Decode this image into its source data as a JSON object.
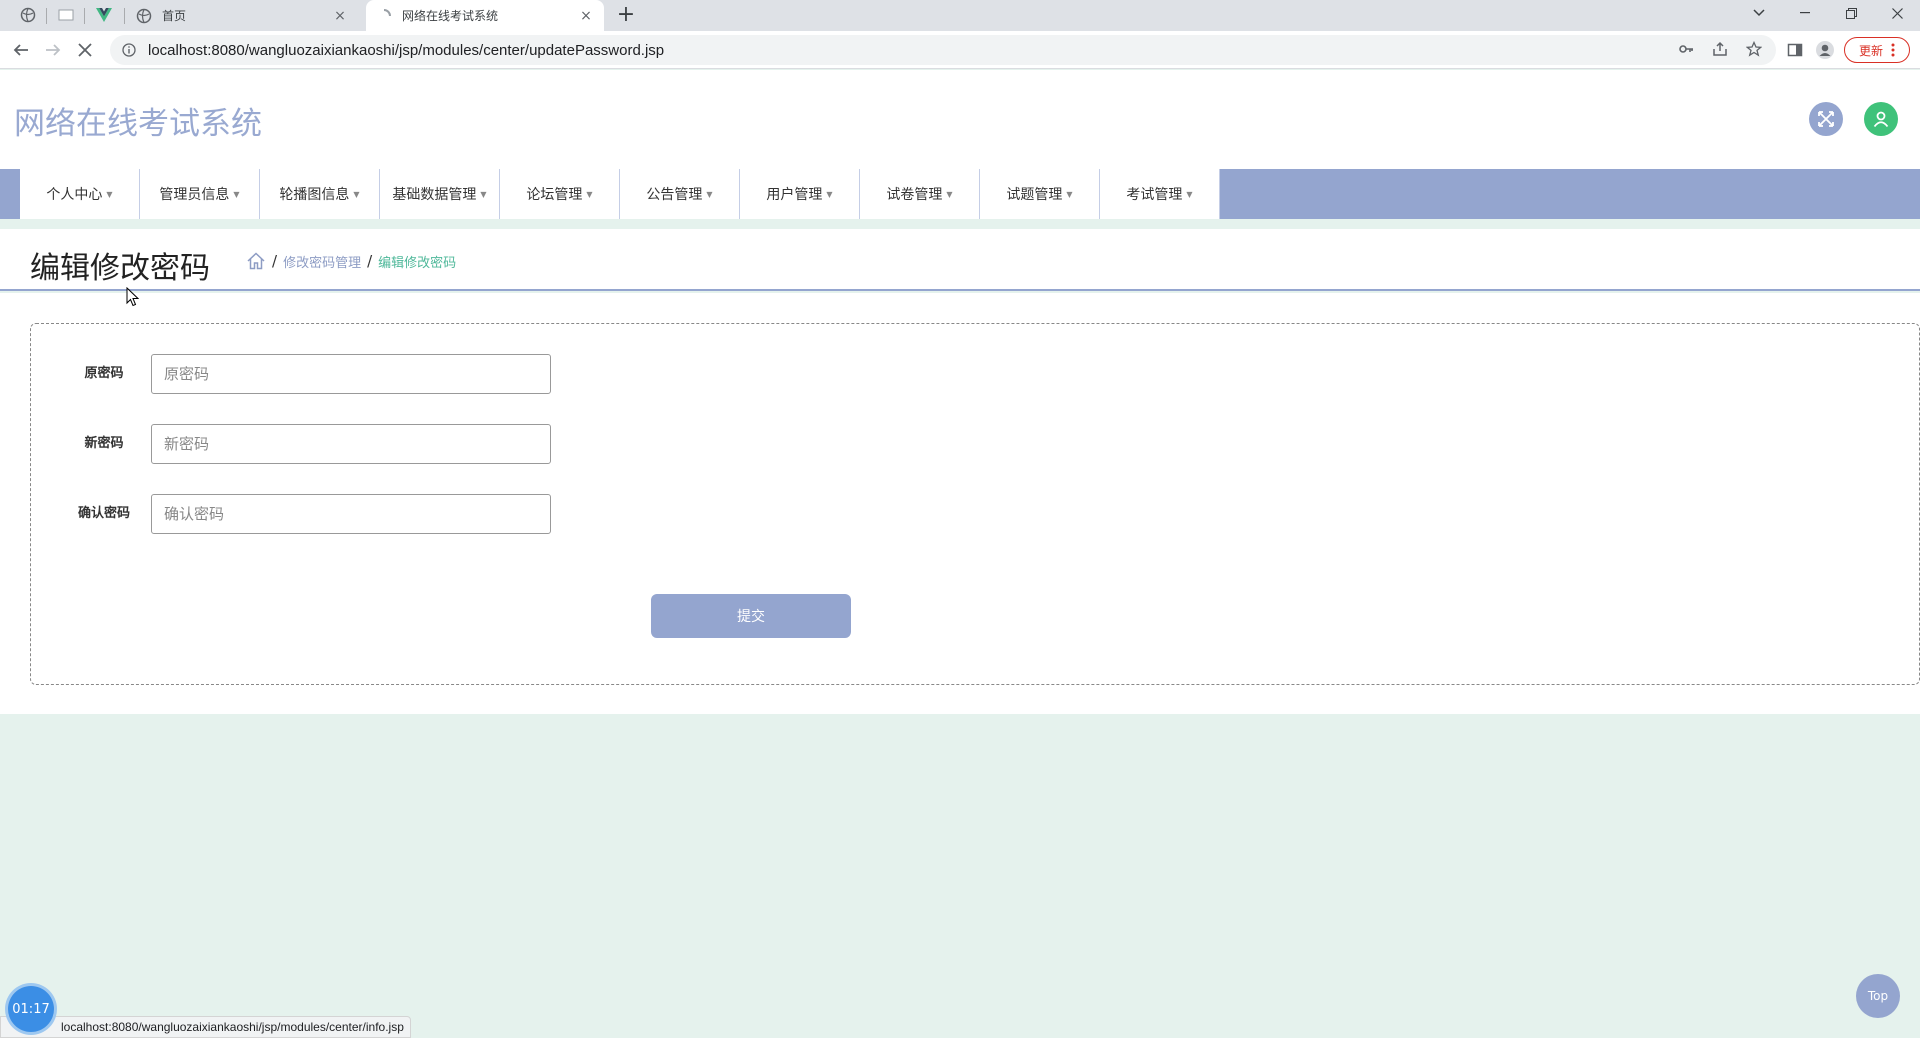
{
  "browser": {
    "tabs": [
      {
        "title": "首页",
        "close": "×"
      },
      {
        "title": "网络在线考试系统",
        "close": "×"
      }
    ],
    "new_tab": "+",
    "url": "localhost:8080/wangluozaixiankaoshi/jsp/modules/center/updatePassword.jsp",
    "update_label": "更新",
    "status_url": "localhost:8080/wangluozaixiankaoshi/jsp/modules/center/info.jsp"
  },
  "header": {
    "site_title": "网络在线考试系统"
  },
  "nav": {
    "items": [
      {
        "label": "个人中心"
      },
      {
        "label": "管理员信息"
      },
      {
        "label": "轮播图信息"
      },
      {
        "label": "基础数据管理"
      },
      {
        "label": "论坛管理"
      },
      {
        "label": "公告管理"
      },
      {
        "label": "用户管理"
      },
      {
        "label": "试卷管理"
      },
      {
        "label": "试题管理"
      },
      {
        "label": "考试管理"
      }
    ]
  },
  "page": {
    "title": "编辑修改密码",
    "breadcrumb": {
      "sep": "/",
      "parent": "修改密码管理",
      "current": "编辑修改密码"
    }
  },
  "form": {
    "fields": [
      {
        "label": "原密码",
        "placeholder": "原密码",
        "value": ""
      },
      {
        "label": "新密码",
        "placeholder": "新密码",
        "value": ""
      },
      {
        "label": "确认密码",
        "placeholder": "确认密码",
        "value": ""
      }
    ],
    "submit_label": "提交"
  },
  "floating": {
    "timer": "01:17",
    "top_label": "Top"
  },
  "colors": {
    "accent": "#94a5cf",
    "breadcrumb_current": "#4fb89a",
    "page_background": "#e5f2ed"
  }
}
